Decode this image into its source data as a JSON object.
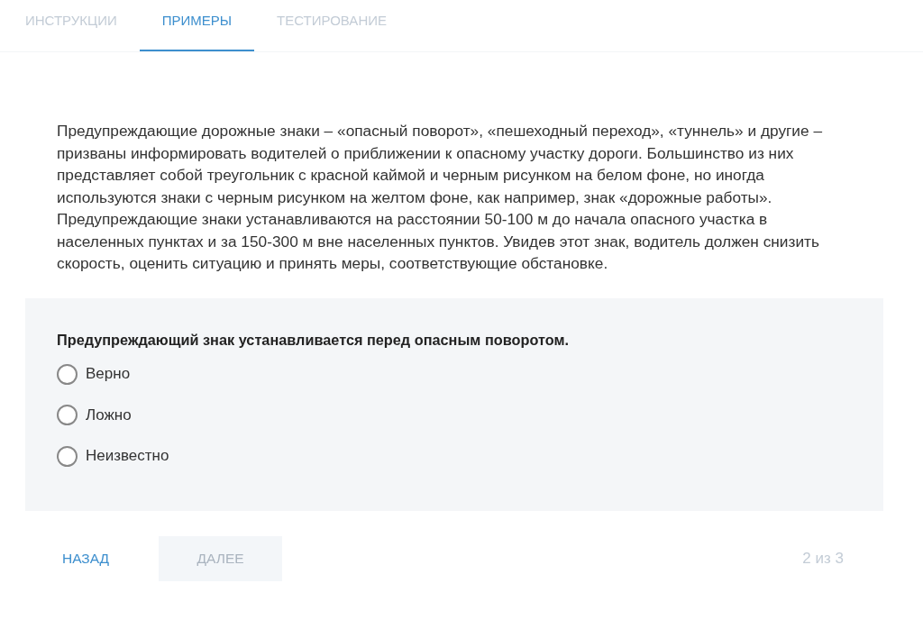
{
  "tabs": [
    {
      "label": "ИНСТРУКЦИИ",
      "selected": false
    },
    {
      "label": "ПРИМЕРЫ",
      "selected": true
    },
    {
      "label": "ТЕСТИРОВАНИЕ",
      "selected": false
    }
  ],
  "passage": "Предупреждающие дорожные знаки – «опасный поворот», «пешеходный переход», «туннель» и другие – призваны информировать водителей о приближении к опасному участку дороги. Большинство из них представляет собой треугольник с красной каймой и черным рисунком на белом фоне, но иногда используются знаки с черным рисунком на желтом фоне, как например, знак «дорожные работы». Предупреждающие знаки устанавливаются на расстоянии 50-100 м до начала опасного участка в населенных пунктах и за 150-300 м вне населенных пунктов. Увидев этот знак, водитель должен снизить скорость, оценить ситуацию и принять меры, соответствующие обстановке.",
  "question": {
    "statement": "Предупреждающий знак устанавливается перед опасным поворотом.",
    "options": [
      {
        "label": "Верно",
        "selected": false
      },
      {
        "label": "Ложно",
        "selected": false
      },
      {
        "label": "Неизвестно",
        "selected": false
      }
    ]
  },
  "footer": {
    "back": {
      "label": "НАЗАД",
      "disabled": false
    },
    "next": {
      "label": "ДАЛЕЕ",
      "disabled": true
    },
    "progress": "2 из 3"
  }
}
